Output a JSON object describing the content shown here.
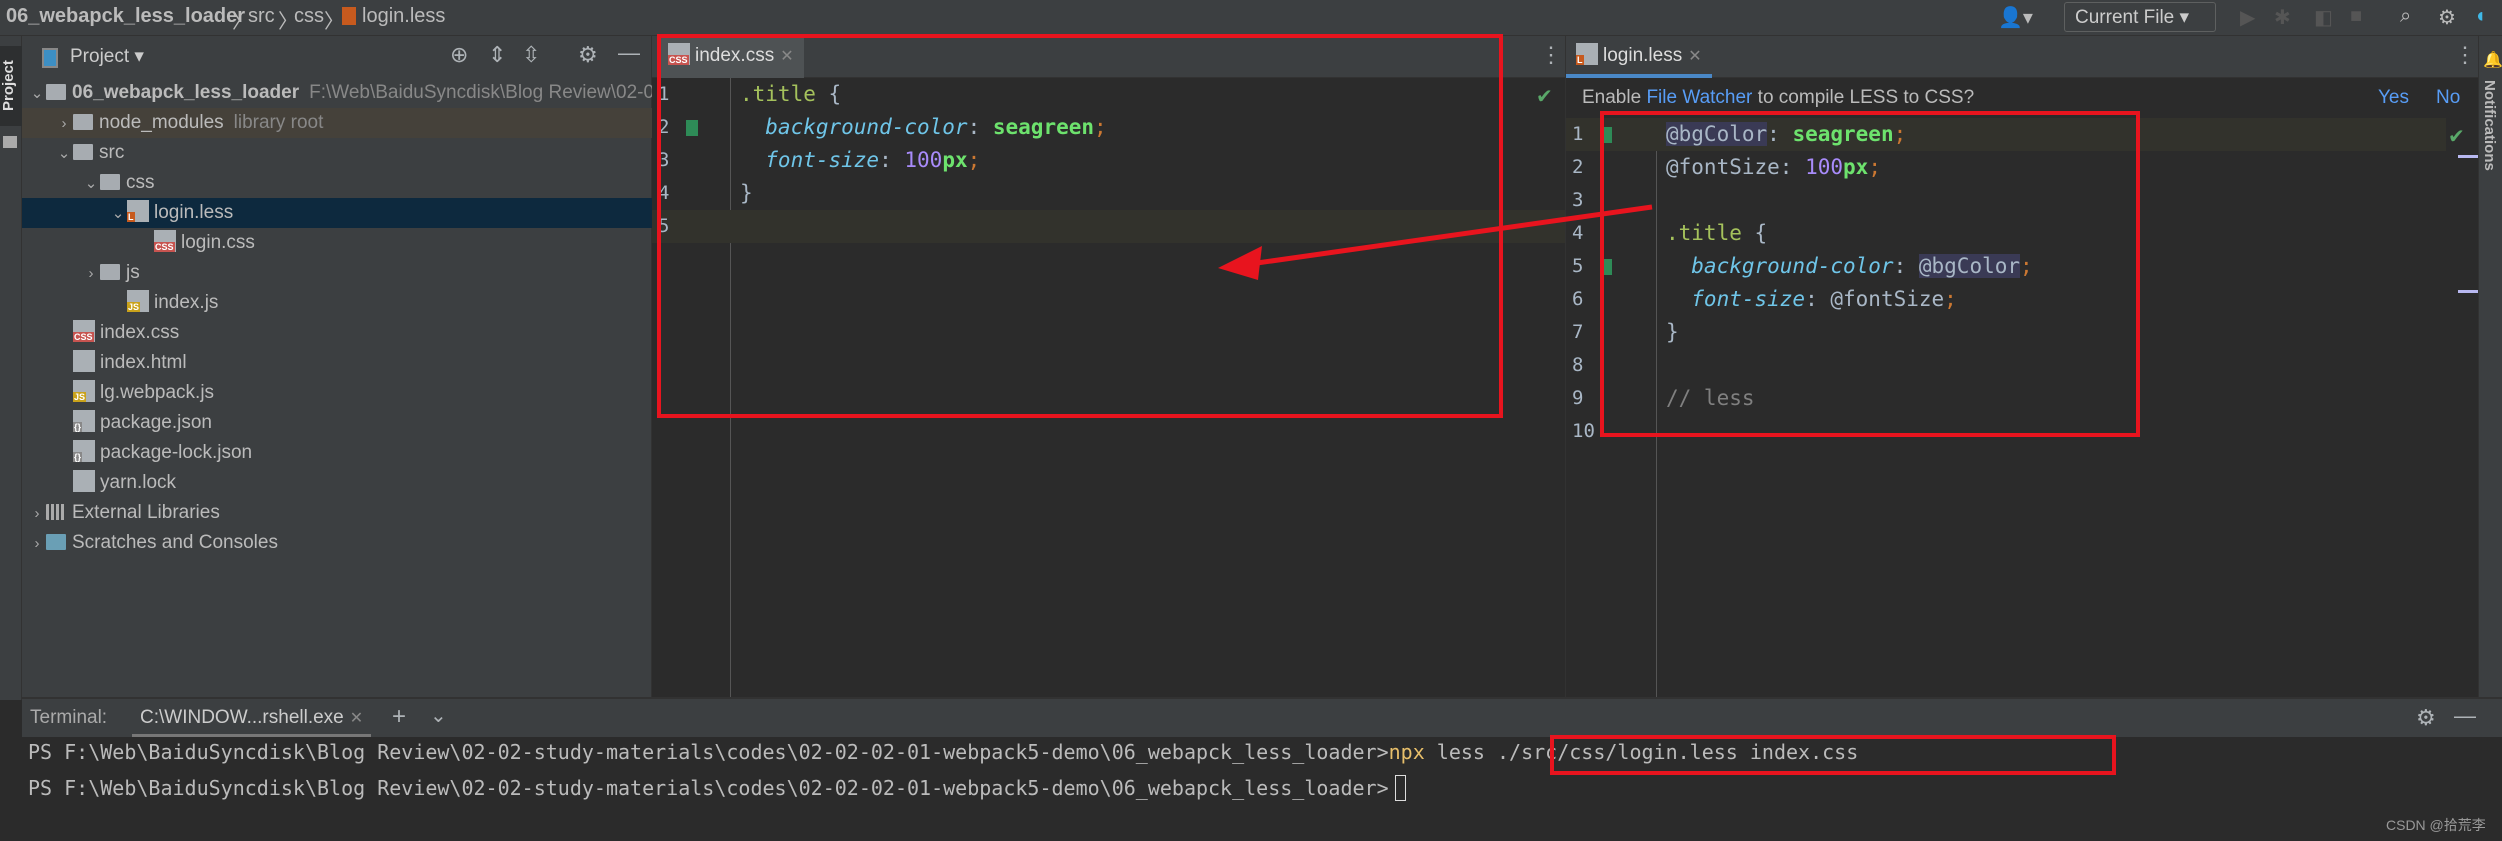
{
  "breadcrumb": [
    "06_webapck_less_loader",
    "src",
    "css",
    "login.less"
  ],
  "toolbar": {
    "run_config": "Current File",
    "icons": [
      "user-icon",
      "run-icon",
      "debug-icon",
      "coverage-icon",
      "stop-icon",
      "search-icon",
      "gear-icon",
      "toolbox-icon"
    ]
  },
  "left_strip": {
    "project_tab": "Project"
  },
  "project_panel": {
    "title": "Project",
    "tree": [
      {
        "label": "06_webapck_less_loader",
        "hint": "F:\\Web\\BaiduSyncdisk\\Blog Review\\02-0",
        "depth": 0,
        "type": "folder",
        "expanded": true,
        "bold": true
      },
      {
        "label": "node_modules",
        "hint": "library root",
        "depth": 1,
        "type": "folder",
        "expanded": false
      },
      {
        "label": "src",
        "depth": 1,
        "type": "folder",
        "expanded": true
      },
      {
        "label": "css",
        "depth": 2,
        "type": "folder",
        "expanded": true
      },
      {
        "label": "login.less",
        "depth": 3,
        "type": "less",
        "expanded": true,
        "selected": true
      },
      {
        "label": "login.css",
        "depth": 4,
        "type": "css"
      },
      {
        "label": "js",
        "depth": 2,
        "type": "folder",
        "expanded": false
      },
      {
        "label": "index.js",
        "depth": 3,
        "type": "js"
      },
      {
        "label": "index.css",
        "depth": 1,
        "type": "css"
      },
      {
        "label": "index.html",
        "depth": 1,
        "type": "html"
      },
      {
        "label": "lg.webpack.js",
        "depth": 1,
        "type": "js"
      },
      {
        "label": "package.json",
        "depth": 1,
        "type": "json"
      },
      {
        "label": "package-lock.json",
        "depth": 1,
        "type": "json"
      },
      {
        "label": "yarn.lock",
        "depth": 1,
        "type": "yarn"
      },
      {
        "label": "External Libraries",
        "depth": 0,
        "type": "lib",
        "expanded": false
      },
      {
        "label": "Scratches and Consoles",
        "depth": 0,
        "type": "scratch",
        "expanded": false
      }
    ]
  },
  "editor_left": {
    "tab": "index.css",
    "tab_badge": "CSS",
    "changed_lines": [
      2
    ],
    "current_line": 5,
    "lines": [
      [
        {
          "t": ".title",
          "c": "#a5c25c"
        },
        {
          "t": " {",
          "c": "#a9b7c6"
        }
      ],
      [
        {
          "t": "  background-color",
          "c": "#6fc5e8",
          "i": true
        },
        {
          "t": ": ",
          "c": "#a9b7c6"
        },
        {
          "t": "seagreen",
          "c": "#6de26d",
          "b": true
        },
        {
          "t": ";",
          "c": "#cc7832"
        }
      ],
      [
        {
          "t": "  font-size",
          "c": "#6fc5e8",
          "i": true
        },
        {
          "t": ": ",
          "c": "#a9b7c6"
        },
        {
          "t": "100",
          "c": "#a88bfa"
        },
        {
          "t": "px",
          "c": "#6de26d",
          "b": true
        },
        {
          "t": ";",
          "c": "#cc7832"
        }
      ],
      [
        {
          "t": "}",
          "c": "#a9b7c6"
        }
      ],
      []
    ]
  },
  "editor_right": {
    "tab": "login.less",
    "tab_badge": "L",
    "notification": {
      "prefix": "Enable ",
      "link": "File Watcher",
      "suffix": " to compile LESS to CSS?",
      "yes": "Yes",
      "no": "No"
    },
    "changed_lines": [
      1,
      5
    ],
    "current_line": 1,
    "lines": [
      [
        {
          "t": "@bgColor",
          "c": "#a9b7c6",
          "h": true
        },
        {
          "t": ": ",
          "c": "#a9b7c6"
        },
        {
          "t": "seagreen",
          "c": "#6de26d",
          "b": true
        },
        {
          "t": ";",
          "c": "#cc7832"
        }
      ],
      [
        {
          "t": "@fontSize",
          "c": "#a9b7c6"
        },
        {
          "t": ": ",
          "c": "#a9b7c6"
        },
        {
          "t": "100",
          "c": "#a88bfa"
        },
        {
          "t": "px",
          "c": "#6de26d",
          "b": true
        },
        {
          "t": ";",
          "c": "#cc7832"
        }
      ],
      [],
      [
        {
          "t": ".title",
          "c": "#a5c25c"
        },
        {
          "t": " {",
          "c": "#a9b7c6"
        }
      ],
      [
        {
          "t": "  background-color",
          "c": "#6fc5e8",
          "i": true
        },
        {
          "t": ": ",
          "c": "#a9b7c6"
        },
        {
          "t": "@bgColor",
          "c": "#a9b7c6",
          "h": true
        },
        {
          "t": ";",
          "c": "#cc7832"
        }
      ],
      [
        {
          "t": "  font-size",
          "c": "#6fc5e8",
          "i": true
        },
        {
          "t": ": ",
          "c": "#a9b7c6"
        },
        {
          "t": "@fontSize",
          "c": "#a9b7c6"
        },
        {
          "t": ";",
          "c": "#cc7832"
        }
      ],
      [
        {
          "t": "}",
          "c": "#a9b7c6"
        }
      ],
      [],
      [
        {
          "t": "// less",
          "c": "#808080"
        }
      ],
      []
    ]
  },
  "right_strip": {
    "notifications": "Notifications"
  },
  "terminal": {
    "label": "Terminal:",
    "tab": "C:\\WINDOW...rshell.exe",
    "lines": [
      {
        "prompt": "PS F:\\Web\\BaiduSyncdisk\\Blog Review\\02-02-study-materials\\codes\\02-02-02-01-webpack5-demo\\06_webapck_less_loader>",
        "cmd": "npx",
        "args": " less ./src/css/login.less index.css"
      },
      {
        "prompt": "PS F:\\Web\\BaiduSyncdisk\\Blog Review\\02-02-study-materials\\codes\\02-02-02-01-webpack5-demo\\06_webapck_less_loader>",
        "cmd": "",
        "args": ""
      }
    ]
  },
  "watermark": "CSDN @拾荒李",
  "colors": {
    "annotation": "#e8141e",
    "accent": "#4a88c7",
    "change_marker": "#2e8b57",
    "link": "#589df6"
  }
}
